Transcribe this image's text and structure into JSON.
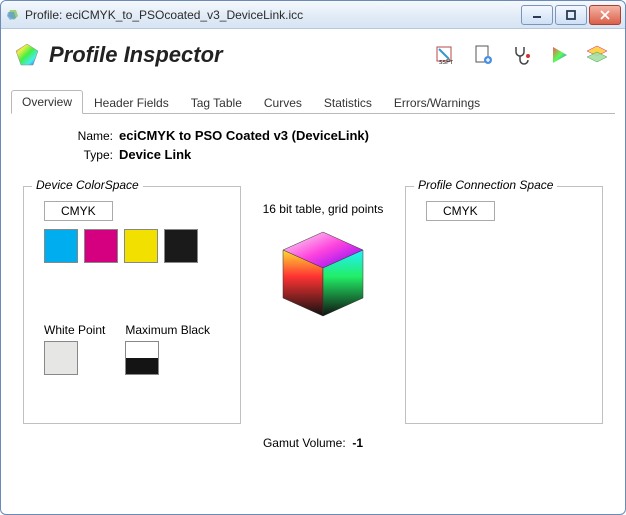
{
  "window": {
    "title": "Profile: eciCMYK_to_PSOcoated_v3_DeviceLink.icc"
  },
  "app": {
    "title": "Profile Inspector"
  },
  "toolbar": {
    "items": [
      {
        "name": "tool-ss-pr-icon"
      },
      {
        "name": "tool-document-icon"
      },
      {
        "name": "tool-stethoscope-icon"
      },
      {
        "name": "tool-play-icon"
      },
      {
        "name": "tool-layers-icon"
      }
    ]
  },
  "tabs": [
    {
      "label": "Overview",
      "active": true
    },
    {
      "label": "Header Fields",
      "active": false
    },
    {
      "label": "Tag Table",
      "active": false
    },
    {
      "label": "Curves",
      "active": false
    },
    {
      "label": "Statistics",
      "active": false
    },
    {
      "label": "Errors/Warnings",
      "active": false
    }
  ],
  "info": {
    "name_label": "Name:",
    "name_value": "eciCMYK to PSO Coated v3 (DeviceLink)",
    "type_label": "Type:",
    "type_value": "Device Link"
  },
  "device_space": {
    "legend": "Device ColorSpace",
    "model": "CMYK",
    "swatches": [
      {
        "color": "#00AEEF",
        "name": "cyan"
      },
      {
        "color": "#D4007F",
        "name": "magenta"
      },
      {
        "color": "#F2E100",
        "name": "yellow"
      },
      {
        "color": "#1A1A1A",
        "name": "black"
      }
    ],
    "white_point_label": "White Point",
    "white_point_color": "#E6E6E4",
    "max_black_label": "Maximum Black",
    "max_black_top": "#FFFFFF",
    "max_black_bottom": "#141414"
  },
  "center": {
    "table_info": "16 bit table,  grid points"
  },
  "pcs": {
    "legend": "Profile Connection Space",
    "model": "CMYK"
  },
  "gamut": {
    "label": "Gamut Volume:",
    "value": "-1"
  }
}
